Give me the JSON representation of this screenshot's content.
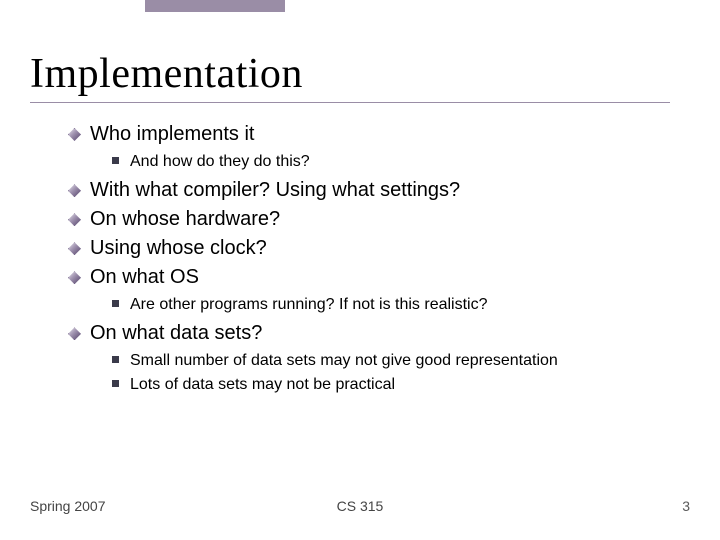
{
  "title": "Implementation",
  "bullets": {
    "b1": "Who implements it",
    "b1_1": "And how do they do this?",
    "b2": "With what compiler? Using what settings?",
    "b3": "On whose hardware?",
    "b4": "Using whose clock?",
    "b5": "On what OS",
    "b5_1": "Are other programs running? If not is this realistic?",
    "b6": "On what data sets?",
    "b6_1": "Small number of data sets may not give good representation",
    "b6_2": "Lots of data sets may not be practical"
  },
  "footer": {
    "left": "Spring 2007",
    "center": "CS 315",
    "right": "3"
  }
}
